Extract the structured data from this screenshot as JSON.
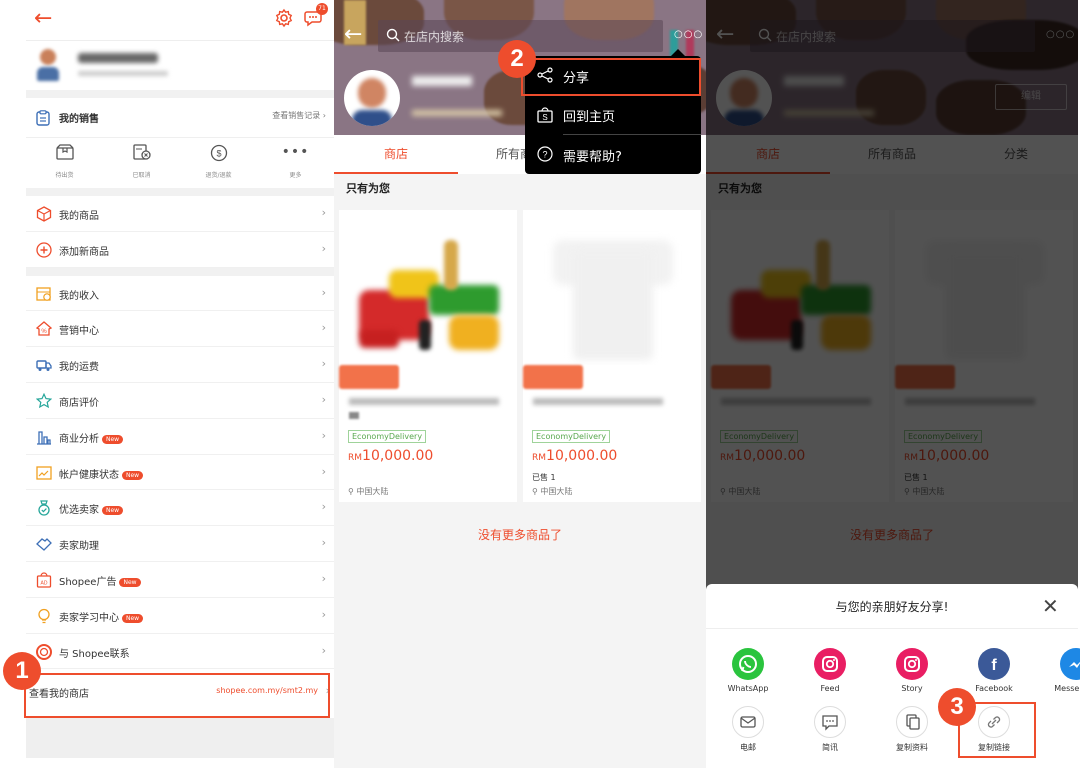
{
  "colors": {
    "brand": "#ee4d2d",
    "whatsapp": "#2ac43e",
    "instagram": "#e91e63",
    "facebook": "#3b5998",
    "messenger": "#1e88e5",
    "economy_delivery": "#5aa84f"
  },
  "panel1": {
    "header": {
      "chat_badge": "71"
    },
    "sales": {
      "label": "我的销售",
      "link": "查看销售记录"
    },
    "quick_actions": [
      {
        "icon": "box-icon",
        "label": "待出货"
      },
      {
        "icon": "cancelled-icon",
        "label": "已取消"
      },
      {
        "icon": "refund-icon",
        "label": "退货/退款"
      },
      {
        "icon": "more-icon",
        "label": "更多"
      }
    ],
    "menu_group_1": [
      {
        "icon": "product-box-icon",
        "label": "我的商品",
        "new": false
      },
      {
        "icon": "add-circle-icon",
        "label": "添加新商品",
        "new": false
      }
    ],
    "menu_group_2": [
      {
        "icon": "income-icon",
        "label": "我的收入",
        "new": false
      },
      {
        "icon": "marketing-icon",
        "label": "营销中心",
        "new": false
      },
      {
        "icon": "truck-icon",
        "label": "我的运费",
        "new": false
      },
      {
        "icon": "star-icon",
        "label": "商店评价",
        "new": false
      },
      {
        "icon": "chart-icon",
        "label": "商业分析",
        "new": true
      },
      {
        "icon": "health-icon",
        "label": "帐户健康状态",
        "new": true
      },
      {
        "icon": "medal-icon",
        "label": "优选卖家",
        "new": true
      },
      {
        "icon": "handshake-icon",
        "label": "卖家助理",
        "new": false
      },
      {
        "icon": "ad-icon",
        "label": "Shopee广告",
        "new": true
      },
      {
        "icon": "bulb-icon",
        "label": "卖家学习中心",
        "new": true
      },
      {
        "icon": "lifebuoy-icon",
        "label": "与 Shopee联系",
        "new": false
      }
    ],
    "new_badge": "New",
    "view_shop": {
      "label": "查看我的商店",
      "url": "shopee.com.my/smt2.my"
    },
    "step": "1"
  },
  "shop": {
    "search_placeholder": "在店内搜索",
    "tabs": [
      "商店",
      "所有商品",
      "分类"
    ],
    "section_title": "只有为您",
    "products": [
      {
        "badge": "EconomyDelivery",
        "currency": "RM",
        "price": "10,000.00",
        "sold": "",
        "location": "中国大陆"
      },
      {
        "badge": "EconomyDelivery",
        "currency": "RM",
        "price": "10,000.00",
        "sold": "已售 1",
        "location": "中国大陆"
      }
    ],
    "no_more": "没有更多商品了",
    "edit_label": "编辑"
  },
  "panel2": {
    "dropdown": [
      {
        "icon": "share-icon",
        "label": "分享"
      },
      {
        "icon": "shop-bag-icon",
        "label": "回到主页"
      },
      {
        "icon": "help-icon",
        "label": "需要帮助?"
      }
    ],
    "step": "2"
  },
  "panel3": {
    "sheet_title": "与您的亲朋好友分享!",
    "share_row_1": [
      {
        "icon": "whatsapp-icon",
        "label": "WhatsApp"
      },
      {
        "icon": "instagram-feed-icon",
        "label": "Feed"
      },
      {
        "icon": "instagram-story-icon",
        "label": "Story"
      },
      {
        "icon": "facebook-icon",
        "label": "Facebook"
      },
      {
        "icon": "messenger-icon",
        "label": "Messenger"
      }
    ],
    "share_row_2": [
      {
        "icon": "email-icon",
        "label": "电邮"
      },
      {
        "icon": "sms-icon",
        "label": "简讯"
      },
      {
        "icon": "copy-info-icon",
        "label": "复制资料"
      },
      {
        "icon": "link-icon",
        "label": "复制链接"
      }
    ],
    "step": "3"
  }
}
